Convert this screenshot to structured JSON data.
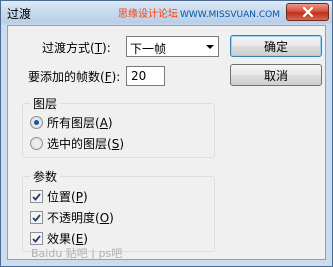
{
  "window": {
    "title": "过渡",
    "watermark_top": "思缘设计论坛",
    "watermark_top_sub": "WWW.MISSVUAN.COM"
  },
  "transition": {
    "label": "过渡方式(",
    "mnemonic": "T",
    "label_end": "):",
    "value": "下一帧"
  },
  "frames": {
    "label": "要添加的帧数(",
    "mnemonic": "F",
    "label_end": "):",
    "value": "20"
  },
  "buttons": {
    "ok": "确定",
    "cancel": "取消"
  },
  "layers": {
    "title": "图层",
    "all": {
      "text": "所有图层(",
      "mnemonic": "A",
      "end": ")",
      "selected": true
    },
    "selected_layers": {
      "text": "选中的图层(",
      "mnemonic": "S",
      "end": ")",
      "selected": false
    }
  },
  "params": {
    "title": "参数",
    "position": {
      "text": "位置(",
      "mnemonic": "P",
      "end": ")",
      "checked": true
    },
    "opacity": {
      "text": "不透明度(",
      "mnemonic": "O",
      "end": ")",
      "checked": true
    },
    "effects": {
      "text": "效果(",
      "mnemonic": "E",
      "end": ")",
      "checked": true
    }
  },
  "watermark_bottom": "Baidu 贴吧 | ps吧"
}
